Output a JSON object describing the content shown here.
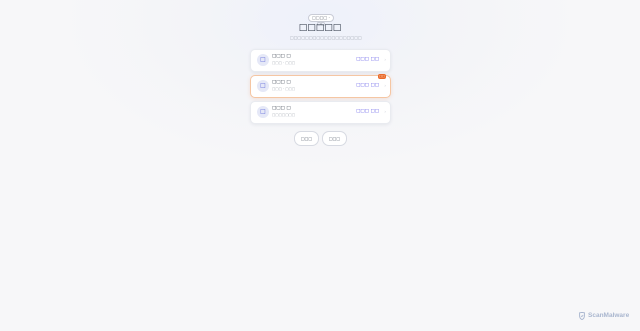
{
  "header": {
    "badge": "□□□□ · □□",
    "title": "□□□□□",
    "subtitle": "□□□□□□□□□□□□□□□□□□□"
  },
  "cards": [
    {
      "icon": "□",
      "name": "□□□ □",
      "meta": "□□□ · □□□",
      "price": "□□□ □□",
      "arrow": "›",
      "tag": ""
    },
    {
      "icon": "□",
      "name": "□□□ □",
      "meta": "□□□ · □□□",
      "price": "□□□ □□",
      "arrow": "›",
      "tag": "□□"
    },
    {
      "icon": "□",
      "name": "□□□ □",
      "meta": "□□□□□□□",
      "price": "□□□ □□",
      "arrow": "›",
      "tag": ""
    }
  ],
  "buttons": {
    "left": "□□□",
    "right": "□□□"
  },
  "watermark": {
    "text": "ScanMalware",
    "icon": "scanmalware-logo-icon"
  },
  "colors": {
    "accent": "#4f46e5",
    "highlight_tag": "#ea6a2a",
    "highlight_border": "#f5c6a3"
  }
}
